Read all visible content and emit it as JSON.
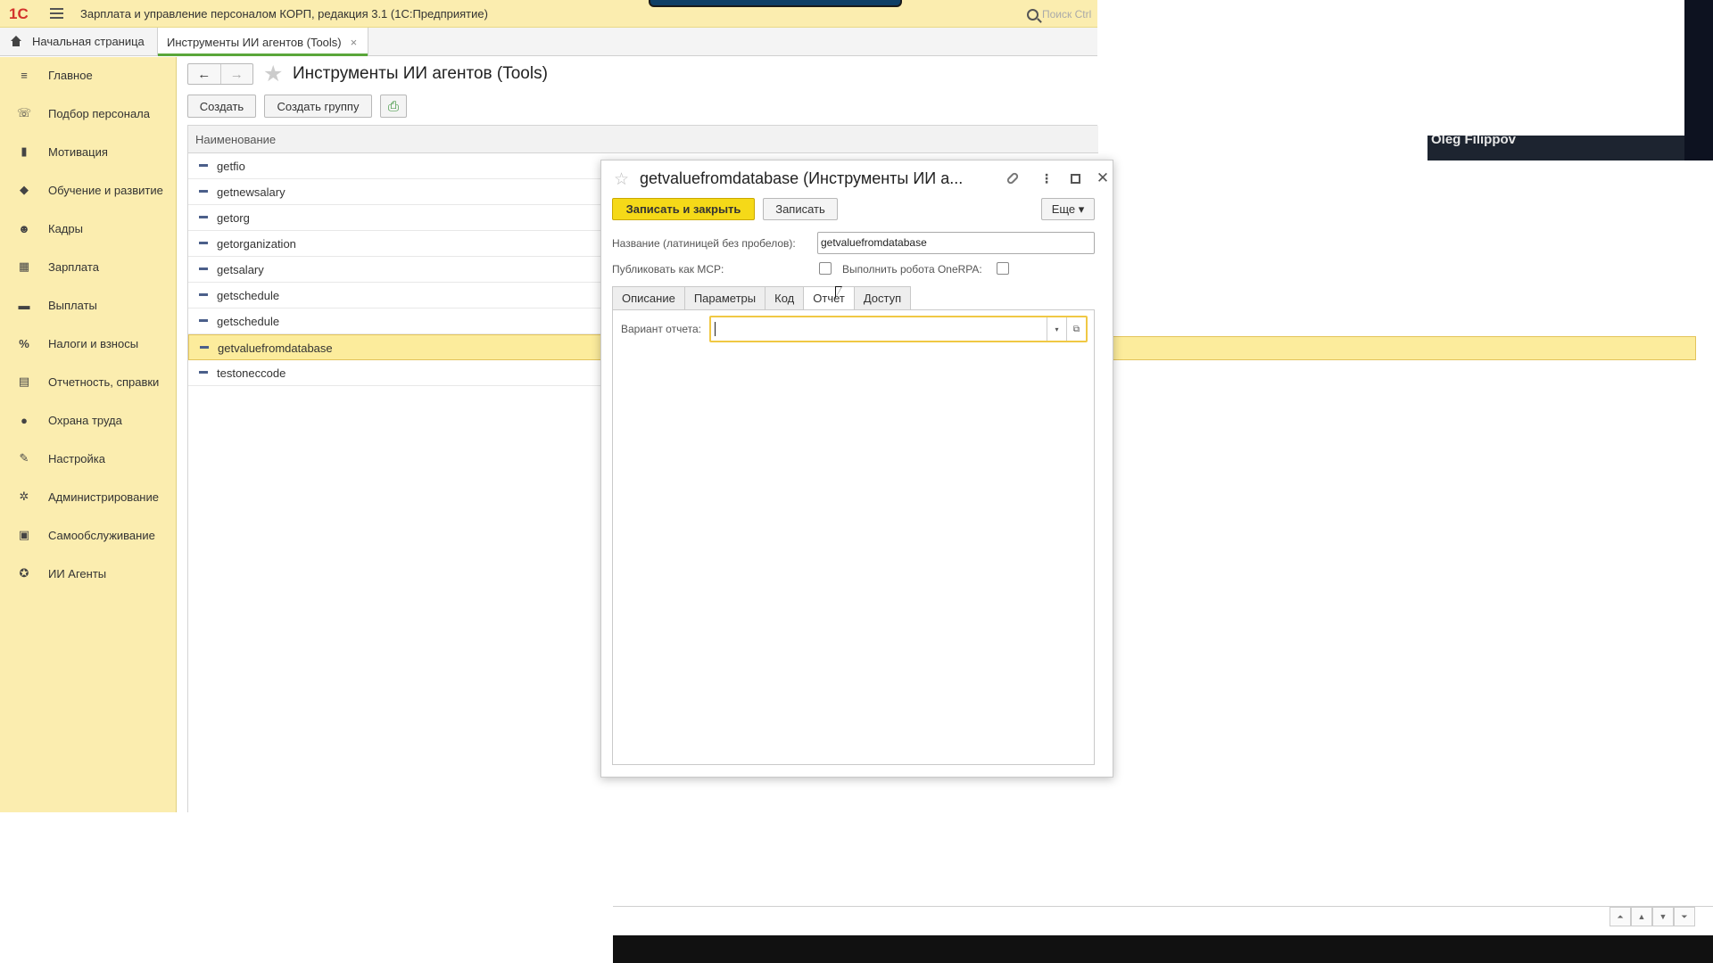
{
  "app": {
    "title": "Зарплата и управление персоналом КОРП, редакция 3.1  (1С:Предприятие)",
    "search_placeholder": "Поиск Ctrl",
    "logo_text": "1С"
  },
  "tabs": {
    "home": "Начальная страница",
    "active": "Инструменты ИИ агентов (Tools)",
    "close": "×"
  },
  "sidebar": {
    "items": [
      {
        "label": "Главное",
        "icon": "≡"
      },
      {
        "label": "Подбор персонала",
        "icon": "☏"
      },
      {
        "label": "Мотивация",
        "icon": "▮"
      },
      {
        "label": "Обучение и развитие",
        "icon": "◆"
      },
      {
        "label": "Кадры",
        "icon": "☻"
      },
      {
        "label": "Зарплата",
        "icon": "▦"
      },
      {
        "label": "Выплаты",
        "icon": "▬"
      },
      {
        "label": "Налоги и взносы",
        "icon": "%"
      },
      {
        "label": "Отчетность, справки",
        "icon": "▤"
      },
      {
        "label": "Охрана труда",
        "icon": "●"
      },
      {
        "label": "Настройка",
        "icon": "✎"
      },
      {
        "label": "Администрирование",
        "icon": "✲"
      },
      {
        "label": "Самообслуживание",
        "icon": "▣"
      },
      {
        "label": "ИИ Агенты",
        "icon": "✪"
      }
    ]
  },
  "page": {
    "title": "Инструменты ИИ агентов (Tools)",
    "back": "←",
    "forward": "→",
    "star": "★",
    "create_label": "Создать",
    "create_group_label": "Создать группу",
    "export_icon": "⎙"
  },
  "list": {
    "column_header": "Наименование",
    "rows": [
      "getfio",
      "getnewsalary",
      "getorg",
      "getorganization",
      "getsalary",
      "getschedule",
      "getschedule",
      "getvaluefromdatabase",
      "testoneccode"
    ],
    "selected_index": 7
  },
  "webcam": {
    "name": "Oleg Filippov"
  },
  "scroll": {
    "buttons": [
      "⏶",
      "▲",
      "▼",
      "⏷"
    ]
  },
  "dialog": {
    "star": "☆",
    "title": "getvaluefromdatabase (Инструменты ИИ а...",
    "dots": "⋮",
    "close": "✕",
    "save_close_label": "Записать и закрыть",
    "save_label": "Записать",
    "more_label": "Еще ▾",
    "name_label": "Название (латиницей без пробелов):",
    "name_value": "getvaluefromdatabase",
    "publish_mcp_label": "Публиковать как MCP:",
    "run_robot_label": "Выполнить робота OneRPA:",
    "tabs": [
      "Описание",
      "Параметры",
      "Код",
      "Отчет",
      "Доступ"
    ],
    "active_tab": 3,
    "report_variant_label": "Вариант отчета:",
    "report_variant_value": "",
    "dropdown_glyph": "▾",
    "open_glyph": "⧉"
  }
}
